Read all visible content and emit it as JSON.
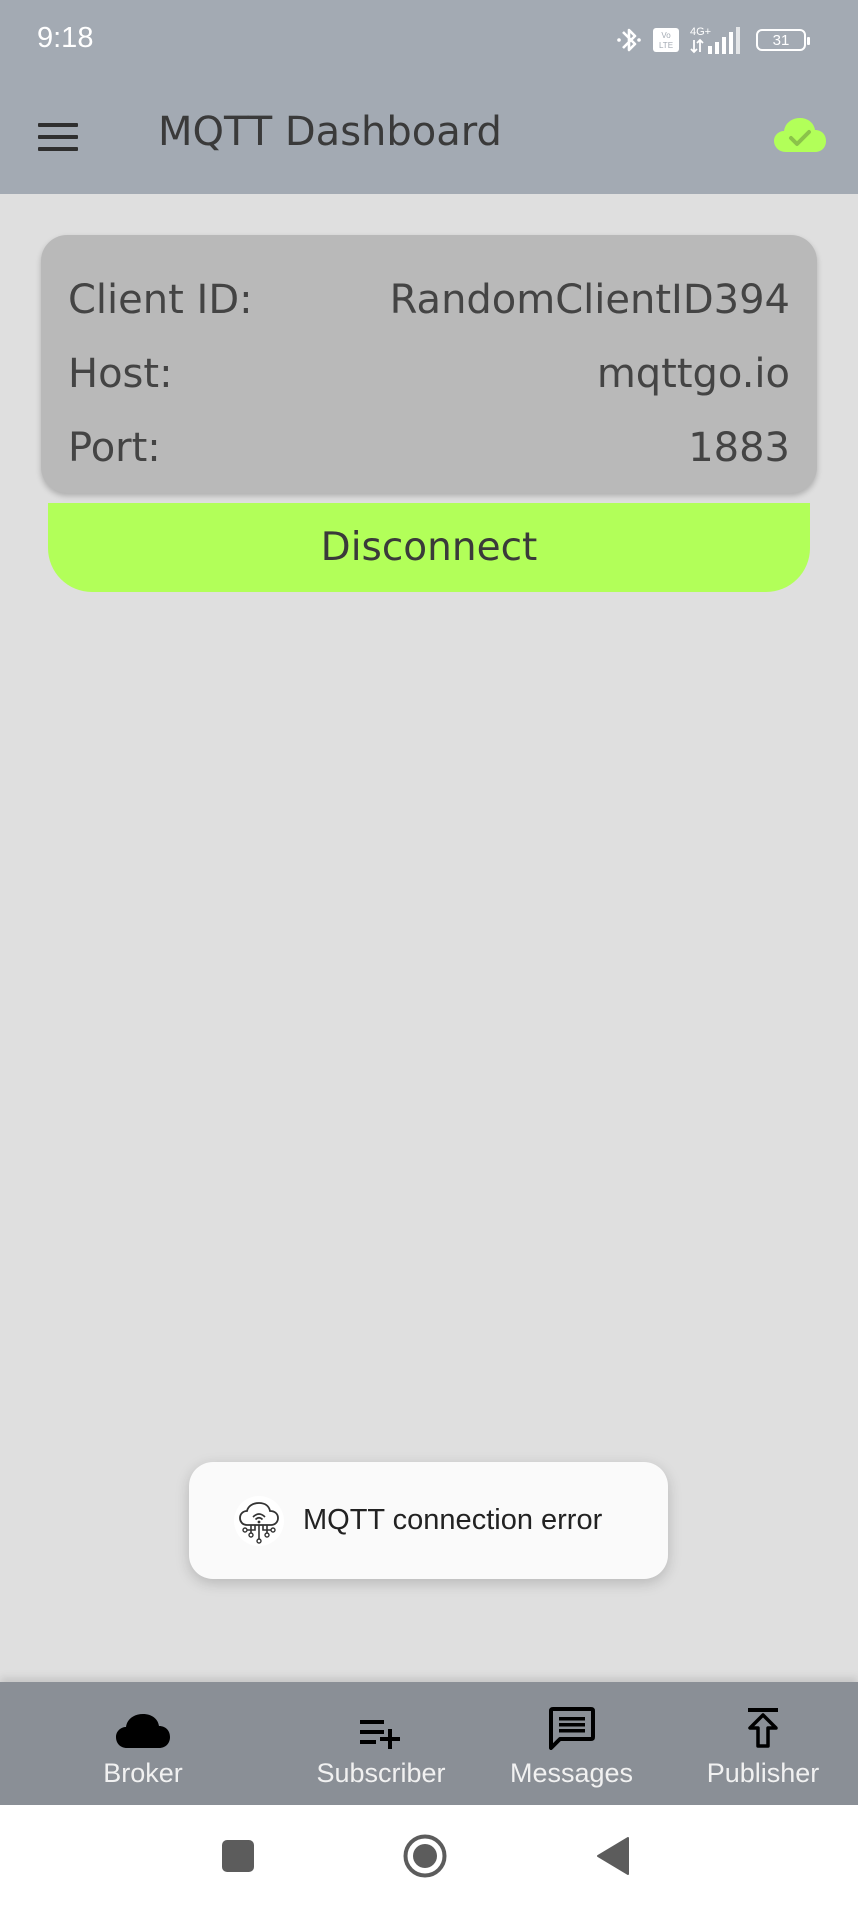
{
  "status_bar": {
    "time": "9:18",
    "battery_level": "31",
    "icons": [
      "bluetooth-icon",
      "volte-icon",
      "signal-4g-icon",
      "battery-icon"
    ]
  },
  "app_bar": {
    "title": "MQTT Dashboard",
    "menu_icon": "hamburger-menu-icon",
    "status_icon": "cloud-check-icon",
    "status_color": "#b2ff59"
  },
  "connection": {
    "rows": [
      {
        "label": "Client ID:",
        "value": "RandomClientID394"
      },
      {
        "label": "Host:",
        "value": "mqttgo.io"
      },
      {
        "label": "Port:",
        "value": "1883"
      }
    ],
    "disconnect_label": "Disconnect",
    "button_color": "#b2ff59"
  },
  "toast": {
    "icon": "cloud-network-icon",
    "message": "MQTT connection error"
  },
  "bottom_nav": {
    "items": [
      {
        "label": "Broker",
        "icon": "cloud-icon",
        "active": true
      },
      {
        "label": "Subscriber",
        "icon": "playlist-add-icon",
        "active": false
      },
      {
        "label": "Messages",
        "icon": "chat-message-icon",
        "active": false
      },
      {
        "label": "Publisher",
        "icon": "publish-icon",
        "active": false
      }
    ]
  },
  "system_nav": {
    "buttons": [
      "recent-apps-icon",
      "home-icon",
      "back-icon"
    ]
  }
}
